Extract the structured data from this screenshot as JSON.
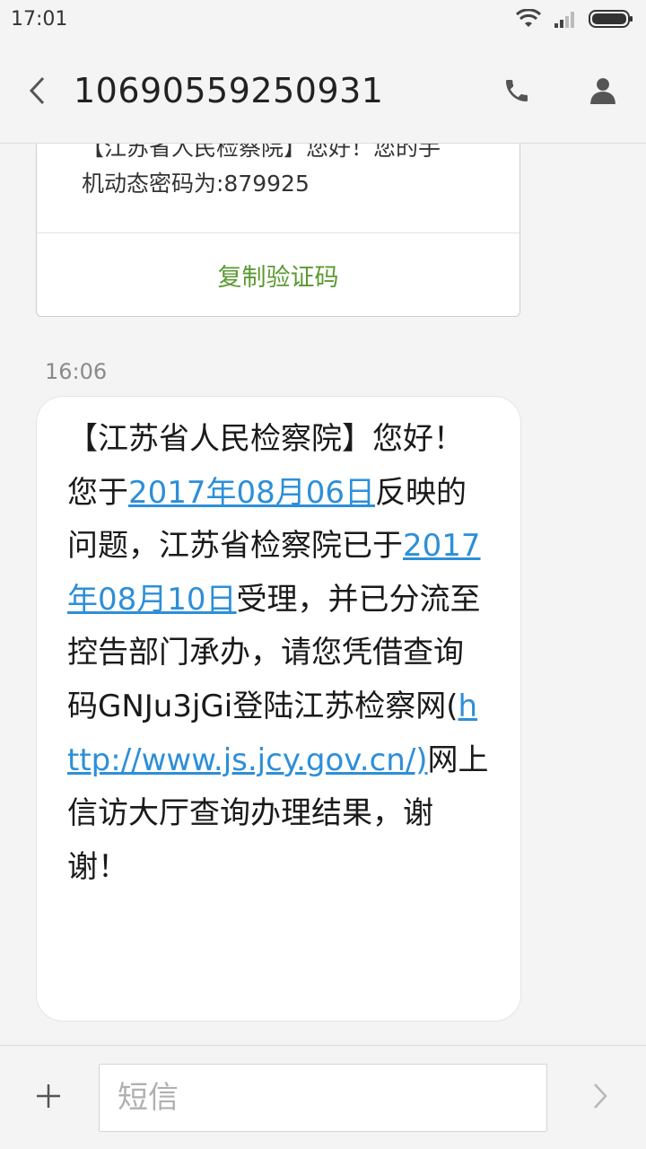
{
  "status_bar": {
    "time": "17:01"
  },
  "header": {
    "title": "10690559250931"
  },
  "previous_message": {
    "line1": "【江苏省人民检察院】您好！您的手",
    "line2": "机动态密码为:879925",
    "copy_label": "复制验证码"
  },
  "message": {
    "timestamp": "16:06",
    "segments": [
      {
        "text": "【江苏省人民检察院】您好！您于",
        "link": false
      },
      {
        "text": "2017年08月06日",
        "link": true
      },
      {
        "text": "反映的问题，江苏省检察院已于",
        "link": false
      },
      {
        "text": "2017年08月10日",
        "link": true
      },
      {
        "text": "受理，并已分流至控告部门承办，请您凭借查询码GNJu3jGi登陆江苏检察网(",
        "link": false
      },
      {
        "text": "http://www.js.jcy.gov.cn/)",
        "link": true
      },
      {
        "text": "网上信访大厅查询办理结果，谢谢！",
        "link": false
      }
    ]
  },
  "compose": {
    "placeholder": "短信"
  },
  "colors": {
    "link": "#2d8fd8",
    "copy_button": "#5b9a32",
    "background": "#f4f4f4"
  }
}
